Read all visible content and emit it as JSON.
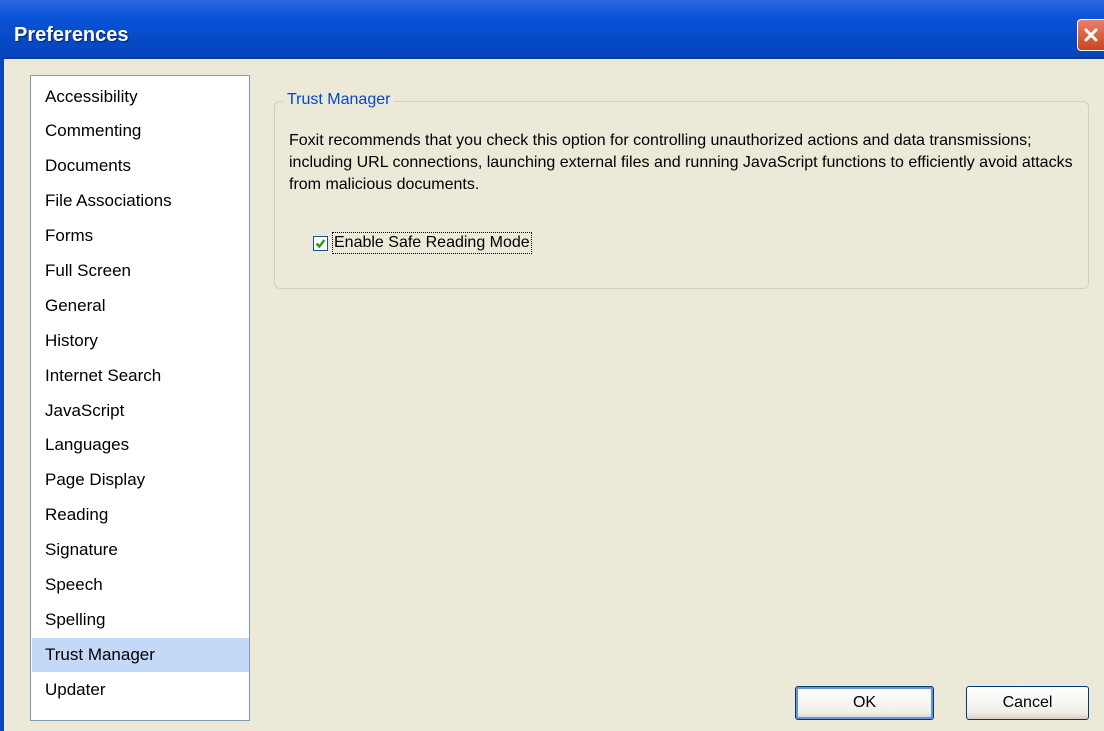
{
  "window": {
    "title": "Preferences"
  },
  "categories": {
    "items": [
      "Accessibility",
      "Commenting",
      "Documents",
      "File Associations",
      "Forms",
      "Full Screen",
      "General",
      "History",
      "Internet Search",
      "JavaScript",
      "Languages",
      "Page Display",
      "Reading",
      "Signature",
      "Speech",
      "Spelling",
      "Trust Manager",
      "Updater"
    ],
    "selected": "Trust Manager"
  },
  "trust_manager": {
    "legend": "Trust Manager",
    "description": "Foxit recommends that you check this option for controlling unauthorized actions and data transmissions; including URL connections, launching external files and running JavaScript functions to efficiently avoid attacks from malicious documents.",
    "safe_reading": {
      "label": "Enable Safe Reading Mode",
      "checked": true
    }
  },
  "buttons": {
    "ok": "OK",
    "cancel": "Cancel"
  },
  "colors": {
    "titlebar": "#0a53d9",
    "selection": "#c4d8f7",
    "legend_text": "#0046d5",
    "checkmark": "#21a121"
  }
}
